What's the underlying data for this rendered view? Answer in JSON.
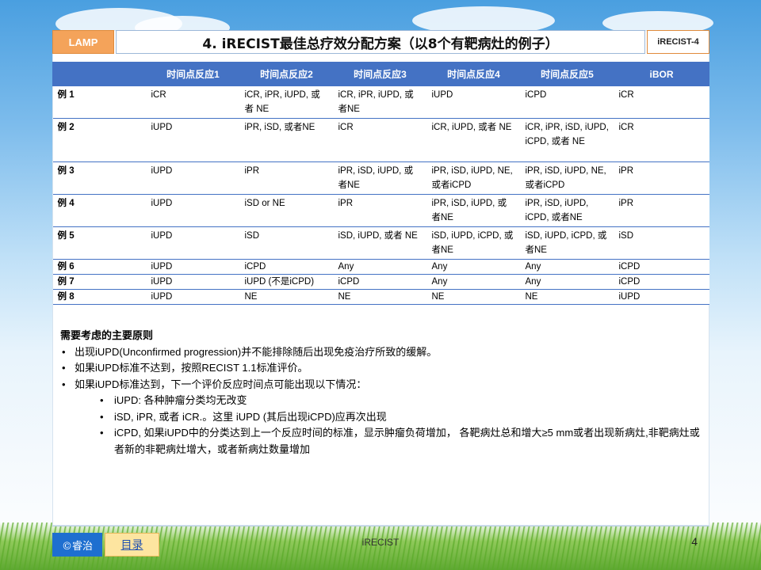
{
  "header": {
    "lamp_label": "LAMP",
    "title": "4. iRECIST最佳总疗效分配方案（以8个有靶病灶的例子）",
    "tag": "iRECIST-4"
  },
  "table": {
    "columns": [
      "",
      "时间点反应1",
      "时间点反应2",
      "时间点反应3",
      "时间点反应4",
      "时间点反应5",
      "iBOR"
    ],
    "rows": [
      [
        "例 1",
        "iCR",
        "iCR, iPR, iUPD, 或者 NE",
        "iCR, iPR, iUPD, 或者NE",
        "iUPD",
        "iCPD",
        "iCR"
      ],
      [
        "例 2",
        "iUPD",
        "iPR, iSD, 或者NE",
        "iCR",
        "iCR, iUPD, 或者 NE",
        "iCR, iPR, iSD, iUPD, iCPD, 或者 NE",
        "iCR"
      ],
      [
        "例 3",
        "iUPD",
        "iPR",
        "iPR, iSD, iUPD, 或者NE",
        "iPR, iSD, iUPD, NE, 或者iCPD",
        "iPR, iSD, iUPD, NE, 或者iCPD",
        "iPR"
      ],
      [
        "例 4",
        "iUPD",
        "iSD or NE",
        "iPR",
        "iPR, iSD, iUPD, 或者NE",
        "iPR, iSD, iUPD, iCPD, 或者NE",
        "iPR"
      ],
      [
        "例 5",
        "iUPD",
        "iSD",
        "iSD, iUPD, 或者 NE",
        "iSD, iUPD, iCPD, 或者NE",
        "iSD, iUPD, iCPD, 或者NE",
        "iSD"
      ],
      [
        "例 6",
        "iUPD",
        "iCPD",
        "Any",
        "Any",
        "Any",
        "iCPD"
      ],
      [
        "例 7",
        "iUPD",
        "iUPD (不是iCPD)",
        "iCPD",
        "Any",
        "Any",
        "iCPD"
      ],
      [
        "例 8",
        "iUPD",
        "NE",
        "NE",
        "NE",
        "NE",
        "iUPD"
      ]
    ]
  },
  "notes": {
    "heading": "需要考虑的主要原则",
    "bullets": [
      "出现iUPD(Unconfirmed progression)并不能排除随后出现免疫治疗所致的缓解。",
      "如果iUPD标准不达到，按照RECIST 1.1标准评价。",
      "如果iUPD标准达到，下一个评价反应时间点可能出现以下情况："
    ],
    "sub_bullets": [
      "iUPD: 各种肿瘤分类均无改变",
      "iSD, iPR, 或者 iCR.。这里 iUPD (其后出现iCPD)应再次出现",
      "iCPD, 如果iUPD中的分类达到上一个反应时间的标准，显示肿瘤负荷增加， 各靶病灶总和增大≥5 mm或者出现新病灶,非靶病灶或者新的非靶病灶增大，或者新病灶数量增加"
    ]
  },
  "footer": {
    "logo_text": "©睿治",
    "toc_label": "目录",
    "center_text": "iRECIST",
    "page_number": "4"
  },
  "colors": {
    "header_blue": "#4472c4",
    "lamp_orange": "#f4a35a",
    "logo_blue": "#1e6fd0",
    "toc_yellow": "#fde5a0"
  }
}
